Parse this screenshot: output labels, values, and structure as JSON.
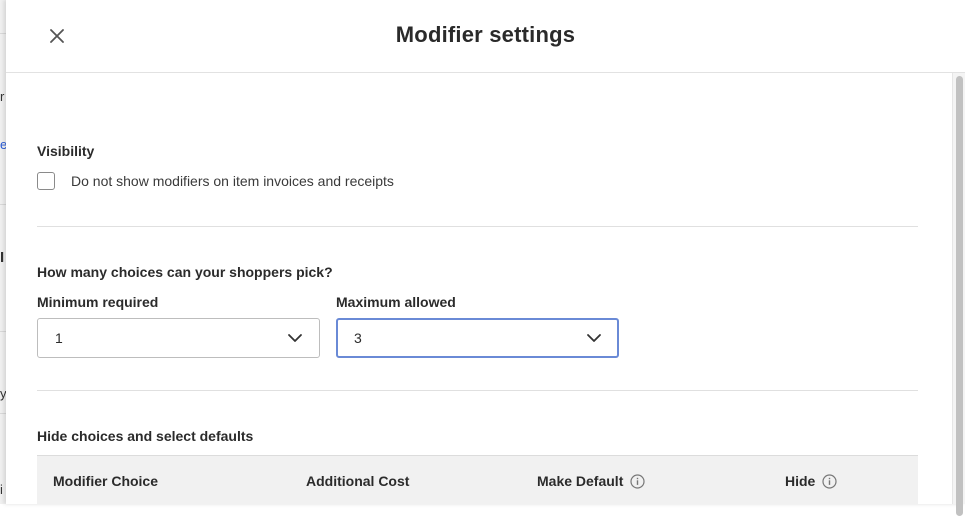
{
  "modal": {
    "title": "Modifier settings"
  },
  "visibility": {
    "heading": "Visibility",
    "checkbox_label": "Do not show modifiers on item invoices and receipts",
    "checked": false
  },
  "choices": {
    "heading": "How many choices can your shoppers pick?",
    "minimum": {
      "label": "Minimum required",
      "value": "1"
    },
    "maximum": {
      "label": "Maximum allowed",
      "value": "3"
    }
  },
  "defaults": {
    "heading": "Hide choices and select defaults",
    "columns": [
      "Modifier Choice",
      "Additional Cost",
      "Make Default",
      "Hide"
    ]
  },
  "icons": {
    "close": "close-icon",
    "dropdown": "chevron-down-icon",
    "info": "info-icon"
  },
  "colors": {
    "focus_border": "#6a8ad6",
    "table_header_bg": "#f1f1f1"
  }
}
